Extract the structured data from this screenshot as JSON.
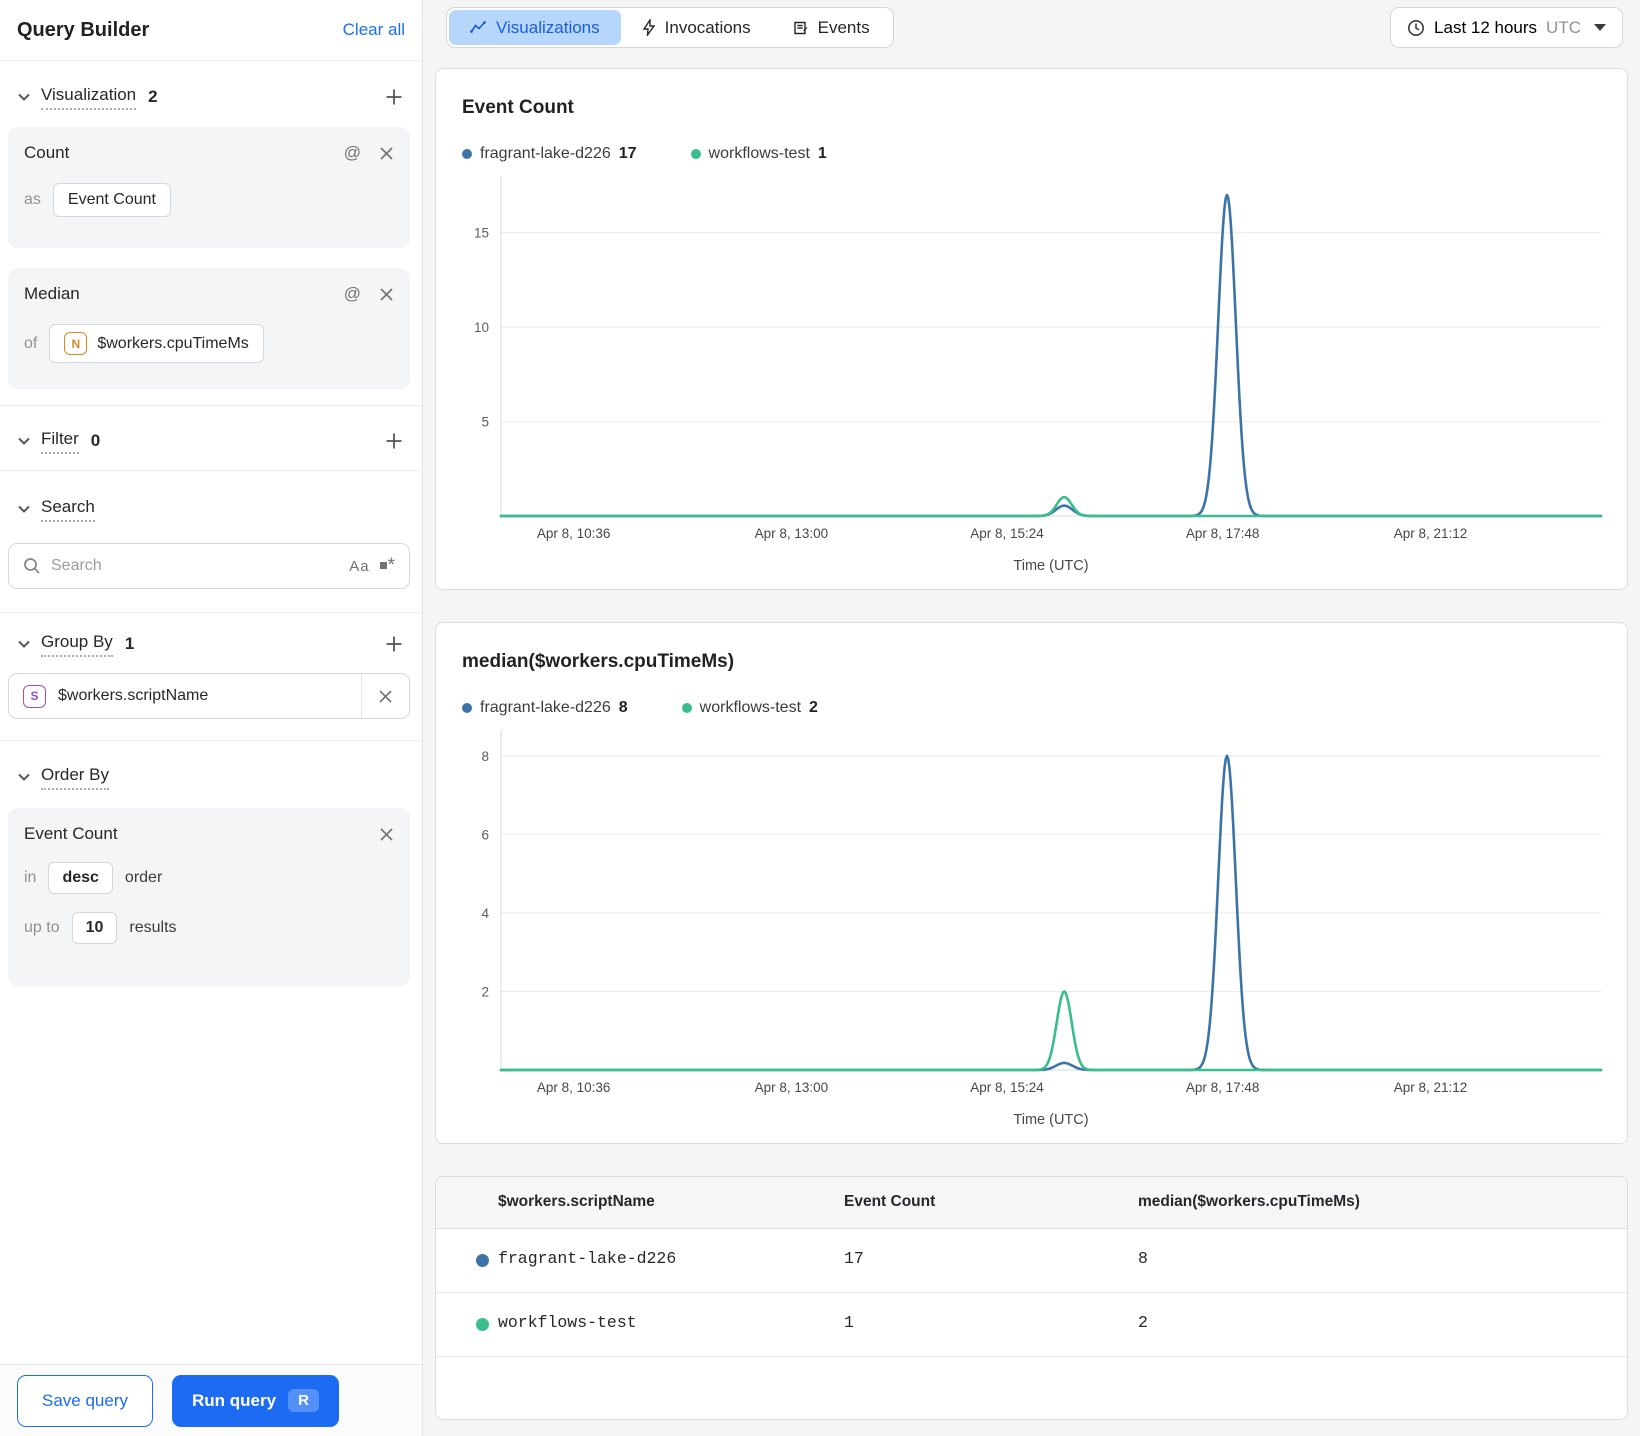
{
  "sidebar": {
    "title": "Query Builder",
    "clear_all": "Clear all",
    "sections": {
      "visualization": {
        "label": "Visualization",
        "count": "2"
      },
      "filter": {
        "label": "Filter",
        "count": "0"
      },
      "search": {
        "label": "Search"
      },
      "group_by": {
        "label": "Group By",
        "count": "1"
      },
      "order_by": {
        "label": "Order By"
      }
    },
    "count_card": {
      "title": "Count",
      "as_label": "as",
      "value": "Event Count"
    },
    "median_card": {
      "title": "Median",
      "of_label": "of",
      "badge": "N",
      "value": "$workers.cpuTimeMs"
    },
    "search_input": {
      "placeholder": "Search",
      "match_case": "Aa"
    },
    "group_by_chip": {
      "badge": "S",
      "value": "$workers.scriptName"
    },
    "order_card": {
      "field": "Event Count",
      "in_label": "in",
      "direction": "desc",
      "order_label": "order",
      "up_to_label": "up to",
      "limit": "10",
      "results_label": "results"
    },
    "save_button": "Save query",
    "run_button": "Run query",
    "run_shortcut": "R"
  },
  "toolbar": {
    "tabs": [
      {
        "label": "Visualizations",
        "icon": "trend-icon",
        "active": true
      },
      {
        "label": "Invocations",
        "icon": "lightning-icon",
        "active": false
      },
      {
        "label": "Events",
        "icon": "events-icon",
        "active": false
      }
    ],
    "time_range": {
      "label": "Last 12 hours",
      "zone": "UTC"
    }
  },
  "chart_data": [
    {
      "type": "line",
      "title": "Event Count",
      "xlabel": "Time (UTC)",
      "ylim": [
        0,
        17.05
      ],
      "y_ticks": [
        5,
        10,
        15
      ],
      "grid": true,
      "legend_position": "top-left",
      "x_ticks": [
        {
          "label": "Apr 8, 10:36",
          "frac": 0.066
        },
        {
          "label": "Apr 8, 13:00",
          "frac": 0.264
        },
        {
          "label": "Apr 8, 15:24",
          "frac": 0.46
        },
        {
          "label": "Apr 8, 17:48",
          "frac": 0.656
        },
        {
          "label": "Apr 8, 21:12",
          "frac": 0.845
        }
      ],
      "series": [
        {
          "name": "fragrant-lake-d226",
          "color": "#3d74a8",
          "legend_value": "17",
          "baseline": 0,
          "spikes": [
            {
              "frac": 0.512,
              "peak": 0.55,
              "sigma": 0.0075
            },
            {
              "frac": 0.66,
              "peak": 17,
              "sigma": 0.008
            }
          ]
        },
        {
          "name": "workflows-test",
          "color": "#38bd8d",
          "legend_value": "1",
          "baseline": 0,
          "spikes": [
            {
              "frac": 0.512,
              "peak": 1,
              "sigma": 0.0068
            }
          ]
        }
      ]
    },
    {
      "type": "line",
      "title": "median($workers.cpuTimeMs)",
      "xlabel": "Time (UTC)",
      "ylim": [
        0,
        8.2
      ],
      "y_ticks": [
        2,
        4,
        6,
        8
      ],
      "grid": true,
      "legend_position": "top-left",
      "x_ticks": [
        {
          "label": "Apr 8, 10:36",
          "frac": 0.066
        },
        {
          "label": "Apr 8, 13:00",
          "frac": 0.264
        },
        {
          "label": "Apr 8, 15:24",
          "frac": 0.46
        },
        {
          "label": "Apr 8, 17:48",
          "frac": 0.656
        },
        {
          "label": "Apr 8, 21:12",
          "frac": 0.845
        }
      ],
      "series": [
        {
          "name": "fragrant-lake-d226",
          "color": "#3d74a8",
          "legend_value": "8",
          "baseline": 0,
          "spikes": [
            {
              "frac": 0.512,
              "peak": 0.18,
              "sigma": 0.0075
            },
            {
              "frac": 0.66,
              "peak": 8,
              "sigma": 0.008
            }
          ]
        },
        {
          "name": "workflows-test",
          "color": "#38bd8d",
          "legend_value": "2",
          "baseline": 0,
          "spikes": [
            {
              "frac": 0.512,
              "peak": 2,
              "sigma": 0.0068
            }
          ]
        }
      ]
    }
  ],
  "table": {
    "columns": [
      "$workers.scriptName",
      "Event Count",
      "median($workers.cpuTimeMs)"
    ],
    "rows": [
      {
        "color": "#3d74a8",
        "name": "fragrant-lake-d226",
        "event_count": "17",
        "median": "8"
      },
      {
        "color": "#38bd8d",
        "name": "workflows-test",
        "event_count": "1",
        "median": "2"
      }
    ]
  },
  "colors": {
    "series_blue": "#3d74a8",
    "series_green": "#38bd8d",
    "accent_blue": "#1d6bf3",
    "selected_tab_bg": "#b7d6fc",
    "gridline": "#ebebed",
    "axis_line": "#d9dadd"
  }
}
